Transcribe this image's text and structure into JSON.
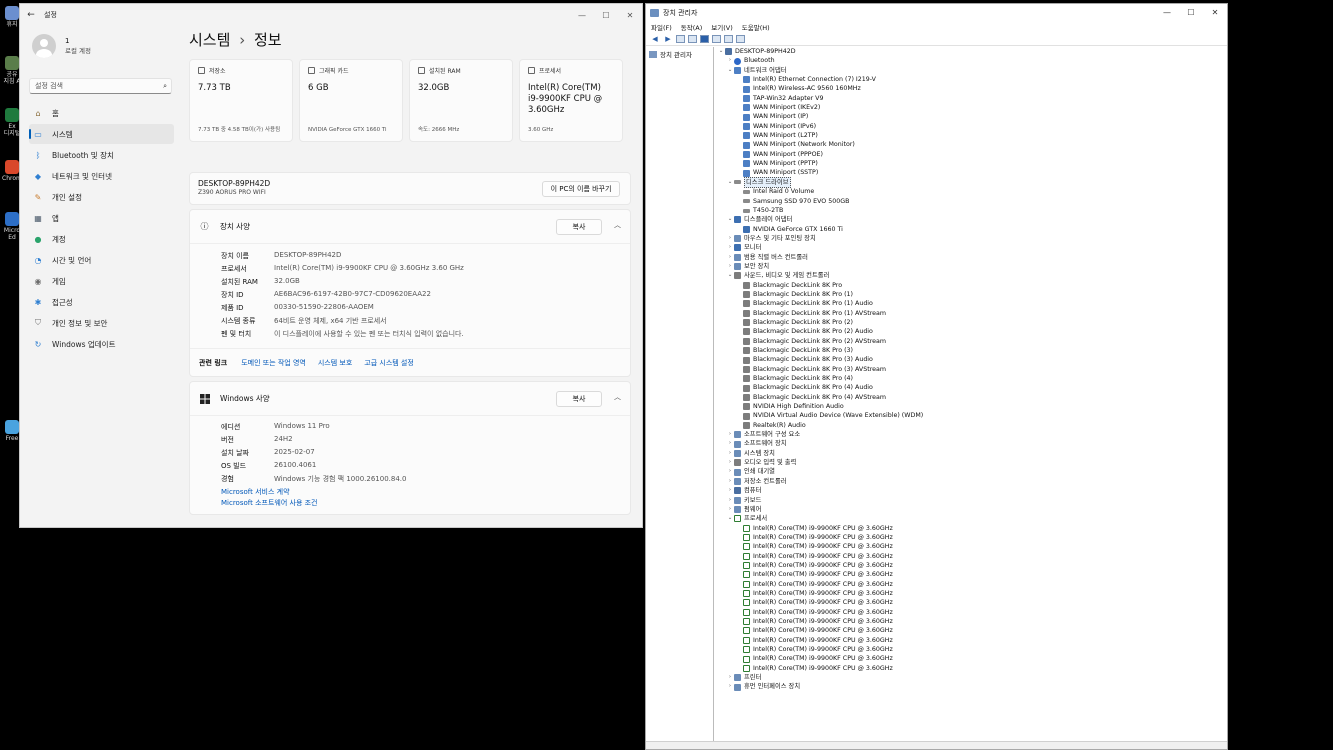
{
  "desktop": {
    "icons": [
      "휴지",
      "공유\n지침 A",
      "Ex\n디지털",
      "Chrome",
      "Micro\nEd",
      "Free"
    ]
  },
  "settings": {
    "window_title": "설정",
    "user": {
      "name": "1",
      "account_type": "로컬 계정"
    },
    "search_placeholder": "설정 검색",
    "nav": [
      {
        "label": "홈",
        "icon": "home-icon",
        "color": "#8a6d3b"
      },
      {
        "label": "시스템",
        "icon": "monitor-icon",
        "color": "#2f7fd1"
      },
      {
        "label": "Bluetooth 및 장치",
        "icon": "bluetooth-icon",
        "color": "#2f7fd1"
      },
      {
        "label": "네트워크 및 인터넷",
        "icon": "wifi-icon",
        "color": "#2f7fd1"
      },
      {
        "label": "개인 설정",
        "icon": "brush-icon",
        "color": "#c77b2d"
      },
      {
        "label": "앱",
        "icon": "apps-icon",
        "color": "#4a5a6a"
      },
      {
        "label": "계정",
        "icon": "person-icon",
        "color": "#2aa36b"
      },
      {
        "label": "시간 및 언어",
        "icon": "globe-icon",
        "color": "#2f7fd1"
      },
      {
        "label": "게임",
        "icon": "gamepad-icon",
        "color": "#6d6d6d"
      },
      {
        "label": "접근성",
        "icon": "accessibility-icon",
        "color": "#2f7fd1"
      },
      {
        "label": "개인 정보 및 보안",
        "icon": "shield-icon",
        "color": "#6d6d6d"
      },
      {
        "label": "Windows 업데이트",
        "icon": "update-icon",
        "color": "#2f7fd1"
      }
    ],
    "breadcrumb": {
      "parent": "시스템",
      "separator": "›",
      "current": "정보"
    },
    "cards": [
      {
        "label": "저장소",
        "value": "7.73 TB",
        "sub": "7.73 TB 중 4.58 TB이(가) 사용됨"
      },
      {
        "label": "그래픽 카드",
        "value": "6 GB",
        "sub": "NVIDIA GeForce GTX 1660 Ti"
      },
      {
        "label": "설치된 RAM",
        "value": "32.0GB",
        "sub": "속도: 2666 MHz"
      },
      {
        "label": "프로세서",
        "value": "Intel(R) Core(TM) i9-9900KF CPU @ 3.60GHz",
        "sub": "3.60 GHz"
      }
    ],
    "pc": {
      "name": "DESKTOP-89PH42D",
      "model": "Z390 AORUS PRO WIFI",
      "rename_label": "이 PC의 이름 바꾸기"
    },
    "device_spec": {
      "title": "장치 사양",
      "copy_label": "복사",
      "rows": [
        {
          "k": "장치 이름",
          "v": "DESKTOP-89PH42D"
        },
        {
          "k": "프로세서",
          "v": "Intel(R) Core(TM) i9-9900KF CPU @ 3.60GHz   3.60 GHz"
        },
        {
          "k": "설치된 RAM",
          "v": "32.0GB"
        },
        {
          "k": "장치 ID",
          "v": "AE6BAC96-6197-42B0-97C7-CD09620EAA22"
        },
        {
          "k": "제품 ID",
          "v": "00330-51590-22806-AAOEM"
        },
        {
          "k": "시스템 종류",
          "v": "64비트 운영 체제, x64 기반 프로세서"
        },
        {
          "k": "펜 및 터치",
          "v": "이 디스플레이에 사용할 수 있는 펜 또는 터치식 입력이 없습니다."
        }
      ]
    },
    "related": {
      "label": "관련 링크",
      "links": [
        "도메인 또는 작업 영역",
        "시스템 보호",
        "고급 시스템 설정"
      ]
    },
    "windows_spec": {
      "title": "Windows 사양",
      "copy_label": "복사",
      "rows": [
        {
          "k": "에디션",
          "v": "Windows 11 Pro"
        },
        {
          "k": "버전",
          "v": "24H2"
        },
        {
          "k": "설치 날짜",
          "v": "2025-02-07"
        },
        {
          "k": "OS 빌드",
          "v": "26100.4061"
        },
        {
          "k": "경험",
          "v": "Windows 기능 경험 팩 1000.26100.84.0"
        }
      ],
      "links": [
        "Microsoft 서비스 계약",
        "Microsoft 소프트웨어 사용 조건"
      ]
    }
  },
  "devmgr": {
    "window_title": "장치 관리자",
    "menu": [
      "파일(F)",
      "동작(A)",
      "보기(V)",
      "도움말(H)"
    ],
    "left_pane": "장치 관리자",
    "tree": [
      {
        "level": 0,
        "exp": "open",
        "label": "DESKTOP-89PH42D",
        "icon": "pc"
      },
      {
        "level": 1,
        "exp": "closed",
        "label": "Bluetooth",
        "icon": "bt"
      },
      {
        "level": 1,
        "exp": "open",
        "label": "네트워크 어댑터",
        "icon": "net"
      },
      {
        "level": 2,
        "label": "Intel(R) Ethernet Connection (7) I219-V",
        "icon": "net"
      },
      {
        "level": 2,
        "label": "Intel(R) Wireless-AC 9560 160MHz",
        "icon": "net"
      },
      {
        "level": 2,
        "label": "TAP-Win32 Adapter V9",
        "icon": "net"
      },
      {
        "level": 2,
        "label": "WAN Miniport (IKEv2)",
        "icon": "net"
      },
      {
        "level": 2,
        "label": "WAN Miniport (IP)",
        "icon": "net"
      },
      {
        "level": 2,
        "label": "WAN Miniport (IPv6)",
        "icon": "net"
      },
      {
        "level": 2,
        "label": "WAN Miniport (L2TP)",
        "icon": "net"
      },
      {
        "level": 2,
        "label": "WAN Miniport (Network Monitor)",
        "icon": "net"
      },
      {
        "level": 2,
        "label": "WAN Miniport (PPPOE)",
        "icon": "net"
      },
      {
        "level": 2,
        "label": "WAN Miniport (PPTP)",
        "icon": "net"
      },
      {
        "level": 2,
        "label": "WAN Miniport (SSTP)",
        "icon": "net"
      },
      {
        "level": 1,
        "exp": "open",
        "label": "디스크 드라이브",
        "icon": "disk",
        "selected": true
      },
      {
        "level": 2,
        "label": "Intel Raid 0 Volume",
        "icon": "disk"
      },
      {
        "level": 2,
        "label": "Samsung SSD 970 EVO 500GB",
        "icon": "disk"
      },
      {
        "level": 2,
        "label": "T450-2TB",
        "icon": "disk"
      },
      {
        "level": 1,
        "exp": "open",
        "label": "디스플레이 어댑터",
        "icon": "disp"
      },
      {
        "level": 2,
        "label": "NVIDIA GeForce GTX 1660 Ti",
        "icon": "disp"
      },
      {
        "level": 1,
        "exp": "closed",
        "label": "마우스 및 기타 포인팅 장치",
        "icon": "gen"
      },
      {
        "level": 1,
        "exp": "closed",
        "label": "모니터",
        "icon": "disp"
      },
      {
        "level": 1,
        "exp": "closed",
        "label": "범용 직렬 버스 컨트롤러",
        "icon": "gen"
      },
      {
        "level": 1,
        "exp": "closed",
        "label": "보안 장치",
        "icon": "gen"
      },
      {
        "level": 1,
        "exp": "open",
        "label": "사운드, 비디오 및 게임 컨트롤러",
        "icon": "snd"
      },
      {
        "level": 2,
        "label": "Blackmagic DeckLink 8K Pro",
        "icon": "snd"
      },
      {
        "level": 2,
        "label": "Blackmagic DeckLink 8K Pro (1)",
        "icon": "snd"
      },
      {
        "level": 2,
        "label": "Blackmagic DeckLink 8K Pro (1) Audio",
        "icon": "snd"
      },
      {
        "level": 2,
        "label": "Blackmagic DeckLink 8K Pro (1) AVStream",
        "icon": "snd"
      },
      {
        "level": 2,
        "label": "Blackmagic DeckLink 8K Pro (2)",
        "icon": "snd"
      },
      {
        "level": 2,
        "label": "Blackmagic DeckLink 8K Pro (2) Audio",
        "icon": "snd"
      },
      {
        "level": 2,
        "label": "Blackmagic DeckLink 8K Pro (2) AVStream",
        "icon": "snd"
      },
      {
        "level": 2,
        "label": "Blackmagic DeckLink 8K Pro (3)",
        "icon": "snd"
      },
      {
        "level": 2,
        "label": "Blackmagic DeckLink 8K Pro (3) Audio",
        "icon": "snd"
      },
      {
        "level": 2,
        "label": "Blackmagic DeckLink 8K Pro (3) AVStream",
        "icon": "snd"
      },
      {
        "level": 2,
        "label": "Blackmagic DeckLink 8K Pro (4)",
        "icon": "snd"
      },
      {
        "level": 2,
        "label": "Blackmagic DeckLink 8K Pro (4) Audio",
        "icon": "snd"
      },
      {
        "level": 2,
        "label": "Blackmagic DeckLink 8K Pro (4) AVStream",
        "icon": "snd"
      },
      {
        "level": 2,
        "label": "NVIDIA High Definition Audio",
        "icon": "snd"
      },
      {
        "level": 2,
        "label": "NVIDIA Virtual Audio Device (Wave Extensible) (WDM)",
        "icon": "snd"
      },
      {
        "level": 2,
        "label": "Realtek(R) Audio",
        "icon": "snd"
      },
      {
        "level": 1,
        "exp": "closed",
        "label": "소프트웨어 구성 요소",
        "icon": "gen"
      },
      {
        "level": 1,
        "exp": "closed",
        "label": "소프트웨어 장치",
        "icon": "gen"
      },
      {
        "level": 1,
        "exp": "closed",
        "label": "시스템 장치",
        "icon": "gen"
      },
      {
        "level": 1,
        "exp": "closed",
        "label": "오디오 입력 및 출력",
        "icon": "snd"
      },
      {
        "level": 1,
        "exp": "closed",
        "label": "인쇄 대기열",
        "icon": "gen"
      },
      {
        "level": 1,
        "exp": "closed",
        "label": "저장소 컨트롤러",
        "icon": "gen"
      },
      {
        "level": 1,
        "exp": "closed",
        "label": "컴퓨터",
        "icon": "pc"
      },
      {
        "level": 1,
        "exp": "closed",
        "label": "키보드",
        "icon": "gen"
      },
      {
        "level": 1,
        "exp": "closed",
        "label": "펌웨어",
        "icon": "gen"
      },
      {
        "level": 1,
        "exp": "open",
        "label": "프로세서",
        "icon": "cpu"
      },
      {
        "level": 2,
        "label": "Intel(R) Core(TM) i9-9900KF CPU @ 3.60GHz",
        "icon": "cpu"
      },
      {
        "level": 2,
        "label": "Intel(R) Core(TM) i9-9900KF CPU @ 3.60GHz",
        "icon": "cpu"
      },
      {
        "level": 2,
        "label": "Intel(R) Core(TM) i9-9900KF CPU @ 3.60GHz",
        "icon": "cpu"
      },
      {
        "level": 2,
        "label": "Intel(R) Core(TM) i9-9900KF CPU @ 3.60GHz",
        "icon": "cpu"
      },
      {
        "level": 2,
        "label": "Intel(R) Core(TM) i9-9900KF CPU @ 3.60GHz",
        "icon": "cpu"
      },
      {
        "level": 2,
        "label": "Intel(R) Core(TM) i9-9900KF CPU @ 3.60GHz",
        "icon": "cpu"
      },
      {
        "level": 2,
        "label": "Intel(R) Core(TM) i9-9900KF CPU @ 3.60GHz",
        "icon": "cpu"
      },
      {
        "level": 2,
        "label": "Intel(R) Core(TM) i9-9900KF CPU @ 3.60GHz",
        "icon": "cpu"
      },
      {
        "level": 2,
        "label": "Intel(R) Core(TM) i9-9900KF CPU @ 3.60GHz",
        "icon": "cpu"
      },
      {
        "level": 2,
        "label": "Intel(R) Core(TM) i9-9900KF CPU @ 3.60GHz",
        "icon": "cpu"
      },
      {
        "level": 2,
        "label": "Intel(R) Core(TM) i9-9900KF CPU @ 3.60GHz",
        "icon": "cpu"
      },
      {
        "level": 2,
        "label": "Intel(R) Core(TM) i9-9900KF CPU @ 3.60GHz",
        "icon": "cpu"
      },
      {
        "level": 2,
        "label": "Intel(R) Core(TM) i9-9900KF CPU @ 3.60GHz",
        "icon": "cpu"
      },
      {
        "level": 2,
        "label": "Intel(R) Core(TM) i9-9900KF CPU @ 3.60GHz",
        "icon": "cpu"
      },
      {
        "level": 2,
        "label": "Intel(R) Core(TM) i9-9900KF CPU @ 3.60GHz",
        "icon": "cpu"
      },
      {
        "level": 2,
        "label": "Intel(R) Core(TM) i9-9900KF CPU @ 3.60GHz",
        "icon": "cpu"
      },
      {
        "level": 1,
        "exp": "closed",
        "label": "프린터",
        "icon": "gen"
      },
      {
        "level": 1,
        "exp": "closed",
        "label": "휴먼 인터페이스 장치",
        "icon": "gen"
      }
    ]
  }
}
